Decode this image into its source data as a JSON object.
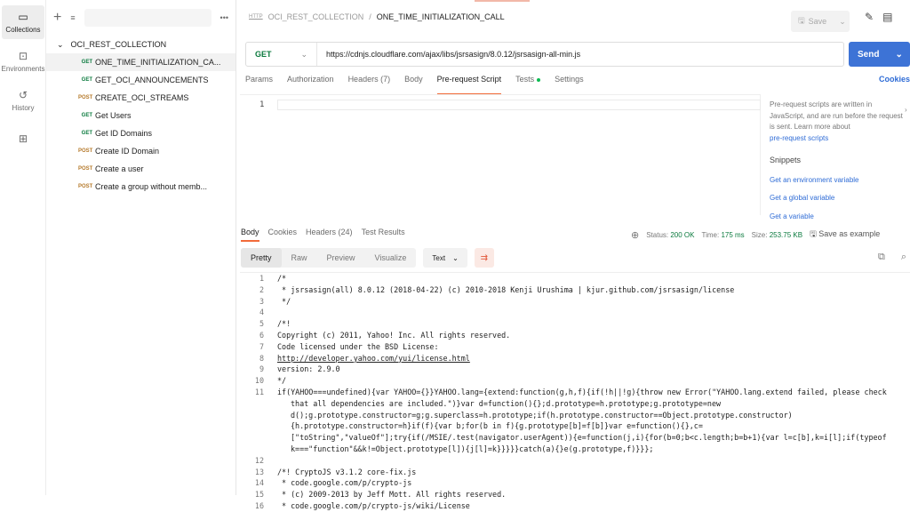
{
  "rail": [
    {
      "label": "Collections",
      "icon": "trash-can-like-collections-icon"
    },
    {
      "label": "Environments",
      "icon": "environment-icon"
    },
    {
      "label": "History",
      "icon": "history-icon"
    }
  ],
  "sidebar": {
    "collection": "OCI_REST_COLLECTION",
    "requests": [
      {
        "method": "GET",
        "name": "ONE_TIME_INITIALIZATION_CA...",
        "active": true
      },
      {
        "method": "GET",
        "name": "GET_OCI_ANNOUNCEMENTS"
      },
      {
        "method": "POST",
        "name": "CREATE_OCI_STREAMS"
      },
      {
        "method": "GET",
        "name": "Get Users"
      },
      {
        "method": "GET",
        "name": "Get ID Domains"
      },
      {
        "method": "POST",
        "name": "Create ID Domain"
      },
      {
        "method": "POST",
        "name": "Create a user"
      },
      {
        "method": "POST",
        "name": "Create a group without memb..."
      }
    ]
  },
  "header": {
    "badge": "HTTP",
    "collection": "OCI_REST_COLLECTION",
    "sep": "/",
    "request": "ONE_TIME_INITIALIZATION_CALL",
    "save": "Save"
  },
  "request": {
    "method": "GET",
    "url": "https://cdnjs.cloudflare.com/ajax/libs/jsrsasign/8.0.12/jsrsasign-all-min.js",
    "send": "Send"
  },
  "tabs": [
    "Params",
    "Authorization",
    "Headers (7)",
    "Body",
    "Pre-request Script",
    "Tests",
    "Settings"
  ],
  "cookies": "Cookies",
  "editor": {
    "line": "1"
  },
  "help": {
    "text": "Pre-request scripts are written in JavaScript, and are run before the request is sent. Learn more about",
    "link": "pre-request scripts",
    "snippets": "Snippets",
    "items": [
      "Get an environment variable",
      "Get a global variable",
      "Get a variable"
    ]
  },
  "response": {
    "tabs": [
      "Body",
      "Cookies",
      "Headers (24)",
      "Test Results"
    ],
    "status_label": "Status:",
    "status": "200 OK",
    "time_label": "Time:",
    "time": "175 ms",
    "size_label": "Size:",
    "size": "253.75 KB",
    "save_example": "Save as example",
    "views": [
      "Pretty",
      "Raw",
      "Preview",
      "Visualize"
    ],
    "format": "Text"
  },
  "code": [
    "/*",
    " * jsrsasign(all) 8.0.12 (2018-04-22) (c) 2010-2018 Kenji Urushima | kjur.github.com/jsrsasign/license",
    " */",
    "",
    "/*!",
    "Copyright (c) 2011, Yahoo! Inc. All rights reserved.",
    "Code licensed under the BSD License:",
    "http://developer.yahoo.com/yui/license.html",
    "version: 2.9.0",
    "*/",
    "if(YAHOO===undefined){var YAHOO={}}YAHOO.lang={extend:function(g,h,f){if(!h||!g){throw new Error(\"YAHOO.lang.extend failed, please check that all dependencies are included.\")}var d=function(){};d.prototype=h.prototype;g.prototype=new d();g.prototype.constructor=g;g.superclass=h.prototype;if(h.prototype.constructor==Object.prototype.constructor){h.prototype.constructor=h}if(f){var b;for(b in f){g.prototype[b]=f[b]}var e=function(){},c=[\"toString\",\"valueOf\"];try{if(/MSIE/.test(navigator.userAgent)){e=function(j,i){for(b=0;b<c.length;b=b+1){var l=c[b],k=i[l];if(typeof k===\"function\"&&k!=Object.prototype[l]){j[l]=k}}}}}catch(a){}e(g.prototype,f)}}};",
    "",
    "/*! CryptoJS v3.1.2 core-fix.js",
    " * code.google.com/p/crypto-js",
    " * (c) 2009-2013 by Jeff Mott. All rights reserved.",
    " * code.google.com/p/crypto-js/wiki/License"
  ]
}
